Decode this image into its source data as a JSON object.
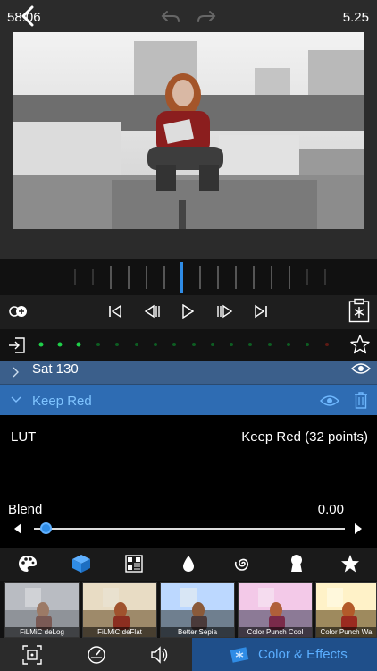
{
  "timeline": {
    "current_time": "58.06",
    "end_time": "5.25"
  },
  "effects": [
    {
      "name": "Sat 130",
      "expanded": false
    },
    {
      "name": "Keep Red",
      "expanded": true
    }
  ],
  "params": {
    "lut_label": "LUT",
    "lut_value": "Keep Red (32 points)",
    "blend_label": "Blend",
    "blend_value": "0.00",
    "blend_level": 0.0
  },
  "thumbnails": [
    {
      "label": "FiLMiC deLog"
    },
    {
      "label": "FiLMiC deFlat"
    },
    {
      "label": "Better Sepia"
    },
    {
      "label": "Color Punch Cool"
    },
    {
      "label": "Color Punch Wa"
    }
  ],
  "bottom_tabs": {
    "active_label": "Color & Effects"
  },
  "colors": {
    "accent": "#2f8ce6",
    "row_selected": "#2e6cb3",
    "row_normal": "#3b5f8b",
    "active_tab": "#1f4f8a",
    "green_dot": "#1fd14a",
    "red_dot": "#c0392b"
  },
  "icons": [
    "back-icon",
    "undo-icon",
    "redo-icon",
    "add-clip-icon",
    "skip-start-icon",
    "frame-back-icon",
    "play-icon",
    "frame-forward-icon",
    "skip-end-icon",
    "clipboard-effect-icon",
    "import-icon",
    "star-icon",
    "chevron-right-icon",
    "chevron-down-icon",
    "eye-icon",
    "trash-icon",
    "palette-icon",
    "cube-icon",
    "lut-grid-icon",
    "drop-icon",
    "swirl-icon",
    "keyhole-icon",
    "favorite-star-icon",
    "crop-icon",
    "speed-icon",
    "audio-icon",
    "color-effects-icon"
  ]
}
